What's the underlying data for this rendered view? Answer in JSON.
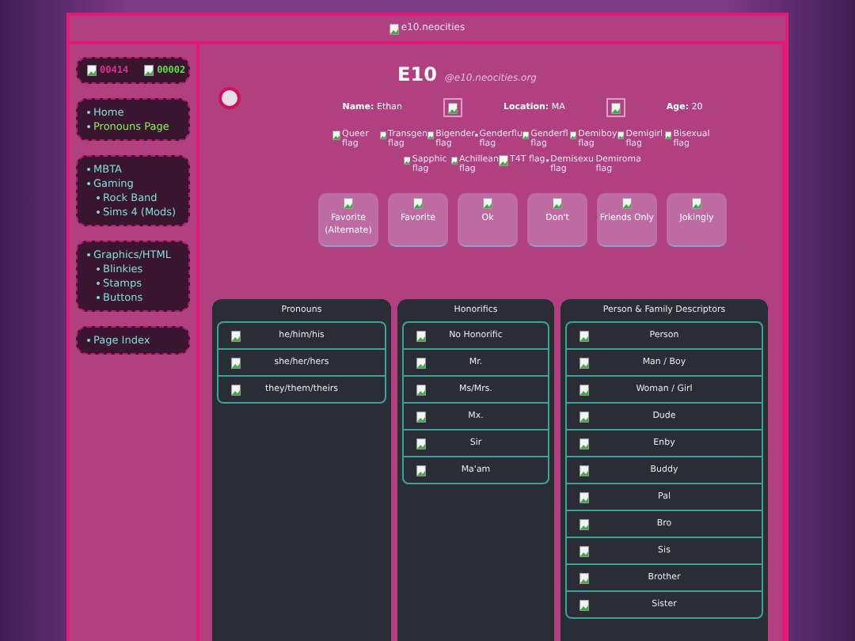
{
  "header": {
    "image_alt": "e10.neocities"
  },
  "counters": [
    {
      "value": "00414",
      "color": "#e0308a"
    },
    {
      "value": "00002",
      "color": "#58e040"
    }
  ],
  "sidebar": {
    "sections": [
      {
        "items": [
          {
            "label": "Home",
            "selected": false
          },
          {
            "label": "Pronouns Page",
            "selected": true
          }
        ]
      },
      {
        "items": [
          {
            "label": "MBTA",
            "selected": false
          },
          {
            "label": "Gaming",
            "selected": false,
            "children": [
              {
                "label": "Rock Band",
                "selected": false
              },
              {
                "label": "Sims 4 (Mods)",
                "selected": false
              }
            ]
          }
        ]
      },
      {
        "items": [
          {
            "label": "Graphics/HTML",
            "selected": false,
            "children": [
              {
                "label": "Blinkies",
                "selected": false
              },
              {
                "label": "Stamps",
                "selected": false
              },
              {
                "label": "Buttons",
                "selected": false
              }
            ]
          }
        ]
      },
      {
        "items": [
          {
            "label": "Page Index",
            "selected": false
          }
        ]
      }
    ]
  },
  "profile": {
    "title": "E10",
    "handle": "@e10.neocities.org",
    "fields": [
      {
        "label": "Name:",
        "value": "Ethan",
        "image": true
      },
      {
        "label": "Location:",
        "value": "MA",
        "image": true
      },
      {
        "label": "Age:",
        "value": "20",
        "image": false
      }
    ]
  },
  "flags": [
    "Queer flag",
    "Transgen flag",
    "Bigender flag",
    "Genderflu flag",
    "Genderfl flag",
    "Demiboy flag",
    "Demigirl flag",
    "Bisexual flag",
    "Sapphic flag",
    "Achillean flag",
    "T4T flag",
    "Demisexu flag",
    "Demiroma flag"
  ],
  "legend": [
    "Favorite (Alternate)",
    "Favorite",
    "Ok",
    "Don't",
    "Friends Only",
    "Jokingly"
  ],
  "cards": [
    {
      "title": "Pronouns",
      "rows": [
        "he/him/his",
        "she/her/hers",
        "they/them/theirs"
      ]
    },
    {
      "title": "Honorifics",
      "rows": [
        "No Honorific",
        "Mr.",
        "Ms/Mrs.",
        "Mx.",
        "Sir",
        "Ma'am"
      ]
    },
    {
      "title": "Person & Family Descriptors",
      "rows": [
        "Person",
        "Man / Boy",
        "Woman / Girl",
        "Dude",
        "Enby",
        "Buddy",
        "Pal",
        "Bro",
        "Sis",
        "Brother",
        "Sister"
      ]
    }
  ]
}
